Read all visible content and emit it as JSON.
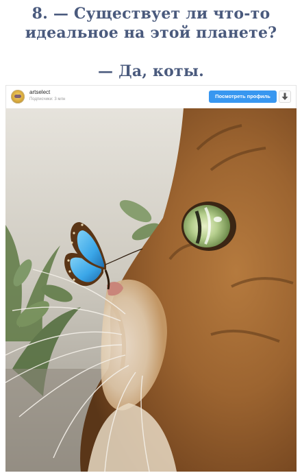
{
  "headline": {
    "question_line1": "8. — Существует ли что-то",
    "question_line2": "идеальное на этой планете?",
    "answer": "— Да, коты."
  },
  "post": {
    "username": "artselect",
    "followers": "Подписчики: 3 млн",
    "profile_button_label": "Посмотреть профиль",
    "download_icon": "download-arrow-icon",
    "avatar_icon": "profile-avatar"
  },
  "colors": {
    "headline": "#4a5a7d",
    "button": "#3897f0",
    "butterfly_blue": "#3aa6e8"
  }
}
